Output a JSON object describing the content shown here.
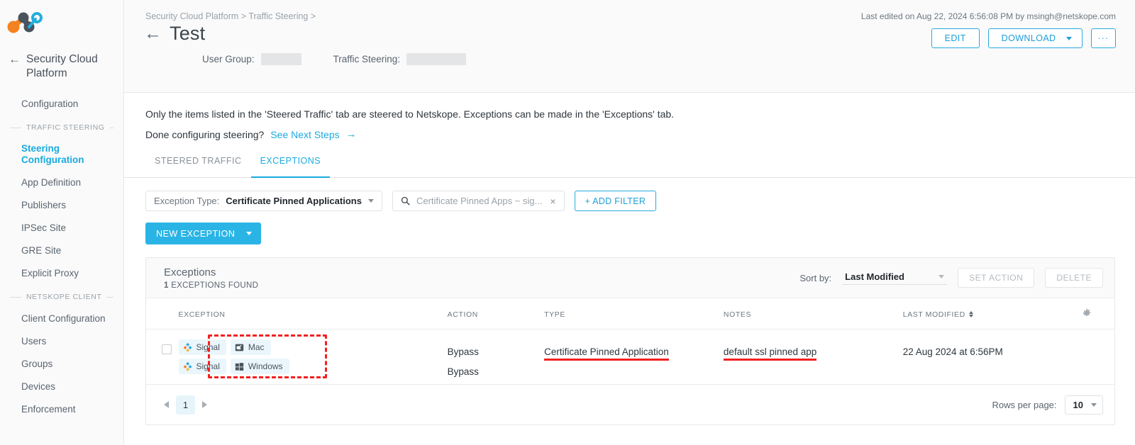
{
  "sidebar": {
    "logo_name": "netskope-logo",
    "back_label": "Security Cloud Platform",
    "items": [
      {
        "label": "Configuration",
        "active": false
      },
      {
        "label": "Steering Configuration",
        "active": true
      },
      {
        "label": "App Definition",
        "active": false
      },
      {
        "label": "Publishers",
        "active": false
      },
      {
        "label": "IPSec Site",
        "active": false
      },
      {
        "label": "GRE Site",
        "active": false
      },
      {
        "label": "Explicit Proxy",
        "active": false
      },
      {
        "label": "Client Configuration",
        "active": false
      },
      {
        "label": "Users",
        "active": false
      },
      {
        "label": "Groups",
        "active": false
      },
      {
        "label": "Devices",
        "active": false
      },
      {
        "label": "Enforcement",
        "active": false
      }
    ],
    "section_traffic_steering": "TRAFFIC STEERING",
    "section_netskope_client": "NETSKOPE CLIENT"
  },
  "header": {
    "breadcrumb": "Security Cloud Platform > Traffic Steering >",
    "title": "Test",
    "back_icon": "←",
    "last_edited": "Last edited on Aug 22, 2024 6:56:08 PM by msingh@netskope.com",
    "edit_label": "EDIT",
    "download_label": "DOWNLOAD",
    "more_label": "···",
    "user_group_label": "User Group:",
    "traffic_steering_label": "Traffic Steering:"
  },
  "info": {
    "line1": "Only the items listed in the 'Steered Traffic' tab are steered to Netskope. Exceptions can be made in the 'Exceptions' tab.",
    "line2_prefix": "Done configuring steering?",
    "line2_link": "See Next Steps",
    "arrow": "→"
  },
  "tabs": [
    {
      "label": "STEERED TRAFFIC",
      "active": false
    },
    {
      "label": "EXCEPTIONS",
      "active": true
    }
  ],
  "filters": {
    "exception_type_key": "Exception Type:",
    "exception_type_value": "Certificate Pinned Applications",
    "search_value": "Certificate Pinned Apps ~ sig...",
    "clear_icon": "×",
    "add_filter_label": "+ ADD FILTER",
    "new_exception_label": "NEW EXCEPTION"
  },
  "panel": {
    "title": "Exceptions",
    "count": "1",
    "count_suffix": "EXCEPTIONS FOUND",
    "sort_by_label": "Sort by:",
    "sort_by_value": "Last Modified",
    "set_action_label": "SET ACTION",
    "delete_label": "DELETE",
    "columns": {
      "exception": "EXCEPTION",
      "action": "ACTION",
      "type": "TYPE",
      "notes": "NOTES",
      "last_modified": "LAST MODIFIED"
    },
    "rows": [
      {
        "badges": [
          [
            {
              "label": "Signal",
              "icon": "signal-icon"
            },
            {
              "label": "Mac",
              "icon": "mac-icon"
            }
          ],
          [
            {
              "label": "Signal",
              "icon": "signal-icon"
            },
            {
              "label": "Windows",
              "icon": "windows-icon"
            }
          ]
        ],
        "action_line1": "Bypass",
        "action_line2": "Bypass",
        "type": "Certificate Pinned Application",
        "notes": "default ssl pinned app",
        "last_modified": "22 Aug 2024 at 6:56PM"
      }
    ]
  },
  "pager": {
    "page": "1",
    "rows_per_page_label": "Rows per page:",
    "rows_per_page_value": "10"
  },
  "colors": {
    "accent": "#1aabdf",
    "primary_button": "#2ab4e5",
    "badge_bg": "#eaf6fb",
    "annotation_red": "#f42020",
    "logo_orange": "#f58220",
    "logo_dark": "#4a545e"
  }
}
